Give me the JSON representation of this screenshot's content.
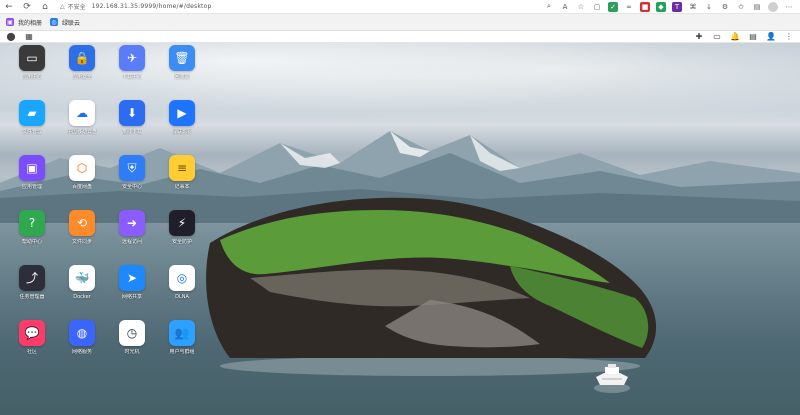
{
  "browser": {
    "security_label": "不安全",
    "url": "192.168.31.35:9999/home/#/desktop"
  },
  "bookmarks": [
    {
      "label": "我的相册",
      "color": "#8e4cf2"
    },
    {
      "label": "绿联云",
      "color": "#2c7be5"
    }
  ],
  "desktop": {
    "icons": [
      {
        "label": "应用中心",
        "color": "#3a3a3a",
        "icon": "tv-icon"
      },
      {
        "label": "应用安全",
        "color": "#2e6ee6",
        "icon": "lock-icon"
      },
      {
        "label": "下载中心",
        "color": "#5b7cf7",
        "icon": "bird-icon"
      },
      {
        "label": "回收站",
        "color": "#3d8cf2",
        "icon": "trash-icon"
      },
      {
        "label": "文件管理",
        "color": "#1aa6ff",
        "icon": "folder-icon"
      },
      {
        "label": "中国移动云盘",
        "color": "#ffffff",
        "icon": "cloud-icon"
      },
      {
        "label": "离线下载",
        "color": "#2b6cf0",
        "icon": "download-icon"
      },
      {
        "label": "绿联影视",
        "color": "#1e74ff",
        "icon": "play-icon"
      },
      {
        "label": "应用管理",
        "color": "#7b4dff",
        "icon": "app-icon"
      },
      {
        "label": "百度网盘",
        "color": "#ffffff",
        "icon": "baidu-icon"
      },
      {
        "label": "安全中心",
        "color": "#2e7cf6",
        "icon": "shield-icon"
      },
      {
        "label": "记事本",
        "color": "#ffcc33",
        "icon": "notes-icon"
      },
      {
        "label": "帮助中心",
        "color": "#2fa84f",
        "icon": "help-icon"
      },
      {
        "label": "文件同步",
        "color": "#ff8a2a",
        "icon": "sync-icon"
      },
      {
        "label": "远程访问",
        "color": "#8b5cff",
        "icon": "arrow-icon"
      },
      {
        "label": "安全防护",
        "color": "#1e1f2a",
        "icon": "bolt-shield-icon"
      },
      {
        "label": "任务管理器",
        "color": "#2c2f3a",
        "icon": "chart-icon"
      },
      {
        "label": "Docker",
        "color": "#ffffff",
        "icon": "docker-icon"
      },
      {
        "label": "网络共享",
        "color": "#1e88ff",
        "icon": "send-icon"
      },
      {
        "label": "DLNA",
        "color": "#ffffff",
        "icon": "dlna-icon"
      },
      {
        "label": "社区",
        "color": "#ff3b6b",
        "icon": "chat-icon"
      },
      {
        "label": "网络服务",
        "color": "#3a66ff",
        "icon": "globe-icon"
      },
      {
        "label": "时光机",
        "color": "#ffffff",
        "icon": "clock-icon"
      },
      {
        "label": "用户与群组",
        "color": "#2ea0ff",
        "icon": "users-icon"
      }
    ]
  }
}
